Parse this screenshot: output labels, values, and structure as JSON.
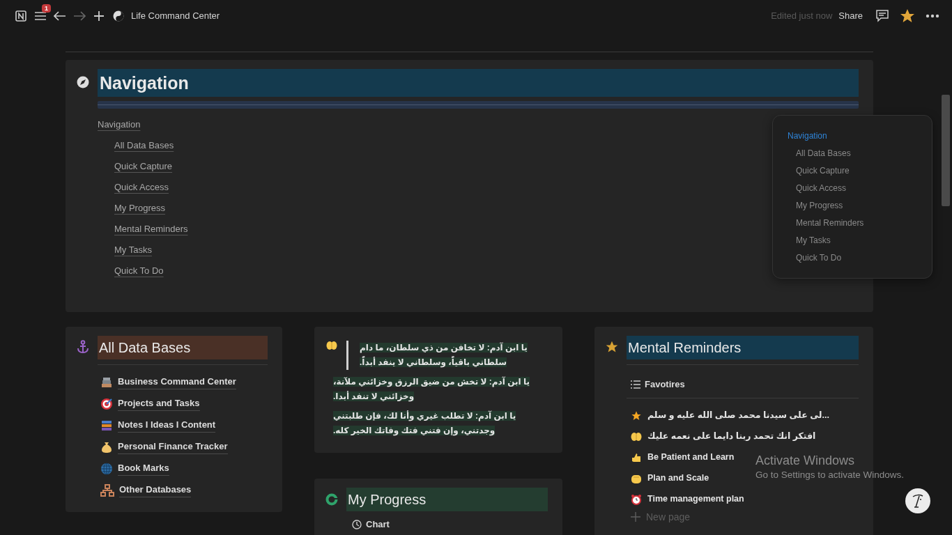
{
  "topbar": {
    "notification_count": "1",
    "page_title": "Life Command Center",
    "edited": "Edited just now",
    "share": "Share",
    "favorited": true
  },
  "navigation": {
    "heading": "Navigation",
    "links": [
      {
        "label": "Navigation",
        "children": [
          {
            "label": "All Data Bases"
          },
          {
            "label": "Quick Capture"
          },
          {
            "label": "Quick Access"
          },
          {
            "label": "My Progress"
          },
          {
            "label": "Mental Reminders"
          },
          {
            "label": "My Tasks"
          },
          {
            "label": "Quick To Do"
          }
        ]
      }
    ]
  },
  "toc": {
    "items": [
      {
        "label": "Navigation",
        "selected": true,
        "children": [
          {
            "label": "All Data Bases",
            "selected": false
          },
          {
            "label": "Quick Capture",
            "selected": false
          },
          {
            "label": "Quick Access",
            "selected": false
          },
          {
            "label": "My Progress",
            "selected": false
          },
          {
            "label": "Mental Reminders",
            "selected": false
          },
          {
            "label": "My Tasks",
            "selected": false
          },
          {
            "label": "Quick To Do",
            "selected": false
          }
        ]
      }
    ]
  },
  "databases": {
    "heading": "All Data Bases",
    "links": [
      {
        "label": "Business Command Center"
      },
      {
        "label": "Projects and Tasks"
      },
      {
        "label": "Notes I Ideas I Content"
      },
      {
        "label": "Personal Finance Tracker"
      },
      {
        "label": "Book Marks"
      },
      {
        "label": "Other Databases"
      }
    ]
  },
  "quotes": [
    {
      "kind": "blockquote",
      "text": "يا ابن آدم: لا تخافن من ذي سلطان، ما دام سلطاني باقياً، وسلطاني لا ينفد أبداً."
    },
    {
      "kind": "paragraph",
      "text": "يا ابن آدم: لا تخش من ضيق الرزق وخزائني ملآنة، وخزائني لا تنفد أبدا."
    },
    {
      "kind": "paragraph",
      "text": "يا ابن آدم: لا تطلب غيري وأنا لك، فإن طلبتني وجدتني، وإن فتني فتك وفاتك الخير كله."
    }
  ],
  "progress": {
    "heading": "My Progress",
    "view": "Chart"
  },
  "reminders": {
    "heading": "Mental Reminders",
    "view": "Favotires",
    "items": [
      {
        "label": "...لى على سيدنا محمد صلى الله عليه و سلم"
      },
      {
        "label": "افتكر انك تحمد ربنا دايما على نعمه عليك"
      },
      {
        "label": "Be Patient and Learn"
      },
      {
        "label": "Plan and Scale"
      },
      {
        "label": "Time management plan"
      }
    ],
    "new_page": "New page"
  },
  "os_notice": {
    "title": "Activate Windows",
    "subtitle": "Go to Settings to activate Windows."
  }
}
